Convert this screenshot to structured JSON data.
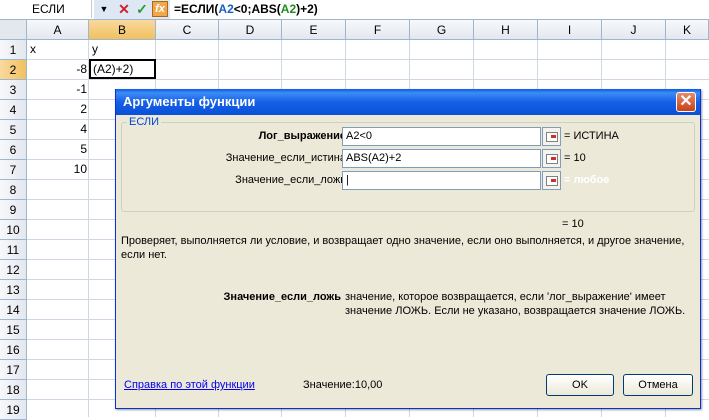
{
  "formula_bar": {
    "name_box": "ЕСЛИ",
    "formula_start": "=ЕСЛИ(",
    "formula_ref1": "A2",
    "formula_mid": "<0;ABS(",
    "formula_ref2": "A2",
    "formula_end": ")+2)",
    "icons": [
      "dropdown-icon",
      "cancel-icon",
      "enter-icon",
      "insert-function-icon"
    ],
    "colors": {
      "cancel": "#d2202f",
      "enter": "#2b9a2b",
      "ref1": "#1b5fbf",
      "ref2": "#1f8e1f"
    }
  },
  "grid": {
    "columns": [
      "A",
      "B",
      "C",
      "D",
      "E",
      "F",
      "G",
      "H",
      "I",
      "J",
      "K"
    ],
    "rows": [
      "1",
      "2",
      "3",
      "4",
      "5",
      "6",
      "7",
      "8",
      "9",
      "10",
      "11",
      "12",
      "13",
      "14",
      "15",
      "16",
      "17",
      "18",
      "19"
    ],
    "cells": {
      "A1": "x",
      "B1": "y",
      "A2": "-8",
      "A3": "-1",
      "A4": "2",
      "A5": "4",
      "A6": "5",
      "A7": "10",
      "B2": "(A2)+2)"
    },
    "active_cell": "B2",
    "selection_color": "#f1c15f"
  },
  "dialog": {
    "title": "Аргументы функции",
    "group_label": "ЕСЛИ",
    "args": [
      {
        "label": "Лог_выражение",
        "value": "A2<0",
        "result": "= ИСТИНА"
      },
      {
        "label": "Значение_если_истина",
        "value": "ABS(A2)+2",
        "result": "= 10"
      },
      {
        "label": "Значение_если_ложь",
        "value": "",
        "result": "= любое"
      }
    ],
    "total_result": "= 10",
    "description": "Проверяет, выполняется ли условие, и возвращает одно значение, если оно выполняется, и другое значение, если нет.",
    "arg_desc_name": "Значение_если_ложь",
    "arg_desc_text": "значение, которое возвращается, если 'лог_выражение' имеет значение ЛОЖЬ. Если не указано, возвращается значение ЛОЖЬ.",
    "help_link": "Справка по этой функции",
    "value_label": "Значение:",
    "value": "10,00",
    "ok_label": "OK",
    "cancel_label": "Отмена",
    "close_icon": "close-icon",
    "title_color": "#0a5be3"
  }
}
